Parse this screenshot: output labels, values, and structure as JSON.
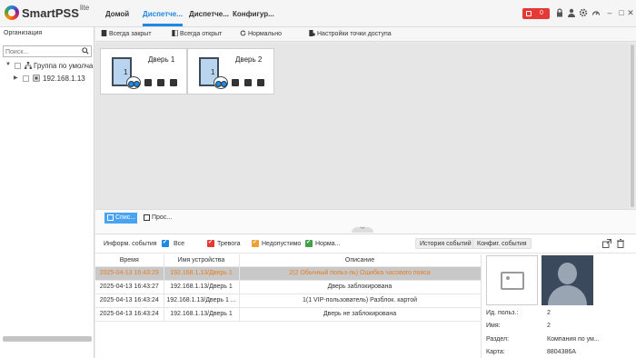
{
  "app": {
    "brand": "SmartPSS",
    "brand_suffix": "lite"
  },
  "nav": {
    "home": "Домой",
    "tab1": "Диспетче...",
    "tab2": "Диспетче...",
    "tab3": "Конфигур..."
  },
  "alarm": {
    "count": "0",
    "color": "#e53935"
  },
  "sidebar": {
    "title": "Организация",
    "search_placeholder": "Поиск...",
    "tree": [
      {
        "label": "Группа по умолча",
        "icon": "org-tree-icon"
      },
      {
        "label": "192.168.1.13",
        "icon": "device-icon"
      }
    ]
  },
  "toolbar": {
    "always_closed": "Всегда закрыт",
    "always_open": "Всегда открыт",
    "normal": "Нормально",
    "access_point_settings": "Настройки точки доступа"
  },
  "doors": [
    {
      "name": "Дверь 1",
      "number": "1"
    },
    {
      "name": "Дверь 2",
      "number": "1"
    }
  ],
  "view_tabs": {
    "tab1": "Спис...",
    "tab2": "Прос..."
  },
  "events": {
    "info_label": "Информ. события",
    "filters": [
      {
        "label": "Все",
        "color": "#1e88e5"
      },
      {
        "label": "Тревога",
        "color": "#e53935"
      },
      {
        "label": "Недопустимо",
        "color": "#f0a030"
      },
      {
        "label": "Норма...",
        "color": "#43a047"
      }
    ],
    "history_button": "История событий",
    "config_button": "Конфиг. события",
    "columns": [
      "Время",
      "Имя устройства",
      "Описание"
    ],
    "rows": [
      {
        "time": "2025-04-13 16:43:29",
        "device": "192.168.1.13/Дверь 1",
        "desc": "2(2 Обычный польз-ль) Ошибка часового пояса"
      },
      {
        "time": "2025-04-13 16:43:27",
        "device": "192.168.1.13/Дверь 1",
        "desc": "Дверь заблокирована"
      },
      {
        "time": "2025-04-13 16:43:24",
        "device": "192.168.1.13/Дверь 1 ...",
        "desc": "1(1 VIP-пользователь) Разблок. картой"
      },
      {
        "time": "2025-04-13 16:43:24",
        "device": "192.168.1.13/Дверь 1",
        "desc": "Дверь не заблокирована"
      }
    ]
  },
  "user_info": {
    "id_label": "Ид. польз.:",
    "id_value": "2",
    "name_label": "Имя:",
    "name_value": "2",
    "dept_label": "Раздел:",
    "dept_value": "Компания по ум...",
    "card_label": "Карта:",
    "card_value": "8804386A"
  }
}
